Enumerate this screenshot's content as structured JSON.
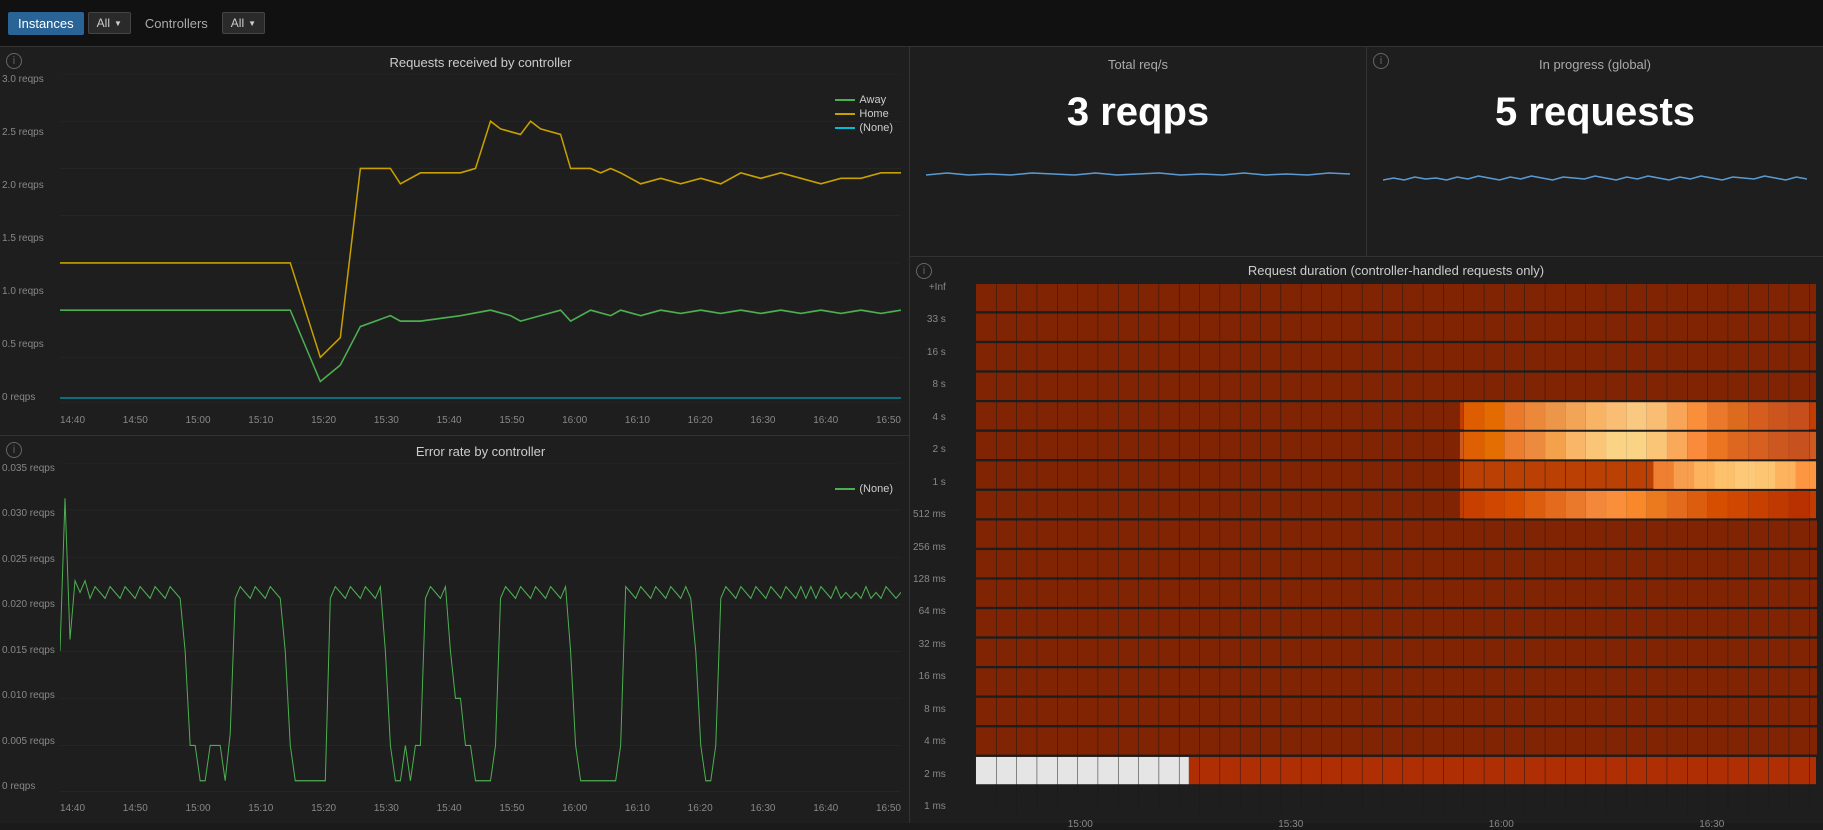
{
  "topbar": {
    "instances_label": "Instances",
    "instances_dropdown": "All",
    "controllers_label": "Controllers",
    "controllers_dropdown": "All"
  },
  "chart1": {
    "title": "Requests received by controller",
    "y_labels": [
      "3.0 reqps",
      "2.5 reqps",
      "2.0 reqps",
      "1.5 reqps",
      "1.0 reqps",
      "0.5 reqps",
      "0 reqps"
    ],
    "x_labels": [
      "14:40",
      "14:50",
      "15:00",
      "15:10",
      "15:20",
      "15:30",
      "15:40",
      "15:50",
      "16:00",
      "16:10",
      "16:20",
      "16:30",
      "16:40",
      "16:50"
    ],
    "legend": [
      {
        "label": "Away",
        "color": "#4caf50"
      },
      {
        "label": "Home",
        "color": "#c8a000"
      },
      {
        "label": "(None)",
        "color": "#00bcd4"
      }
    ]
  },
  "chart2": {
    "title": "Error rate by controller",
    "y_labels": [
      "0.035 reqps",
      "0.030 reqps",
      "0.025 reqps",
      "0.020 reqps",
      "0.015 reqps",
      "0.010 reqps",
      "0.005 reqps",
      "0 reqps"
    ],
    "x_labels": [
      "14:40",
      "14:50",
      "15:00",
      "15:10",
      "15:20",
      "15:30",
      "15:40",
      "15:50",
      "16:00",
      "16:10",
      "16:20",
      "16:30",
      "16:40",
      "16:50"
    ],
    "legend": [
      {
        "label": "(None)",
        "color": "#4caf50"
      }
    ]
  },
  "stat1": {
    "title": "Total req/s",
    "value": "3 reqps"
  },
  "stat2": {
    "title": "In progress (global)",
    "value": "5 requests",
    "info_icon": "i"
  },
  "heatmap": {
    "title": "Request duration (controller-handled requests only)",
    "y_labels": [
      "+Inf",
      "33 s",
      "16 s",
      "8 s",
      "4 s",
      "2 s",
      "1 s",
      "512 ms",
      "256 ms",
      "128 ms",
      "64 ms",
      "32 ms",
      "16 ms",
      "8 ms",
      "4 ms",
      "2 ms",
      "1 ms"
    ],
    "x_labels": [
      "15:00",
      "15:30",
      "16:00",
      "16:30"
    ],
    "info_icon": "i"
  },
  "colors": {
    "bg": "#1a1a1a",
    "panel_bg": "#1e1e1e",
    "border": "#333",
    "accent_blue": "#2a6496",
    "chart_green": "#4caf50",
    "chart_gold": "#c8a000",
    "chart_cyan": "#00bcd4",
    "heat_low": "#8b2500",
    "heat_mid": "#d44000",
    "heat_high": "#ff8c00",
    "heat_peak": "#ffcc88"
  }
}
